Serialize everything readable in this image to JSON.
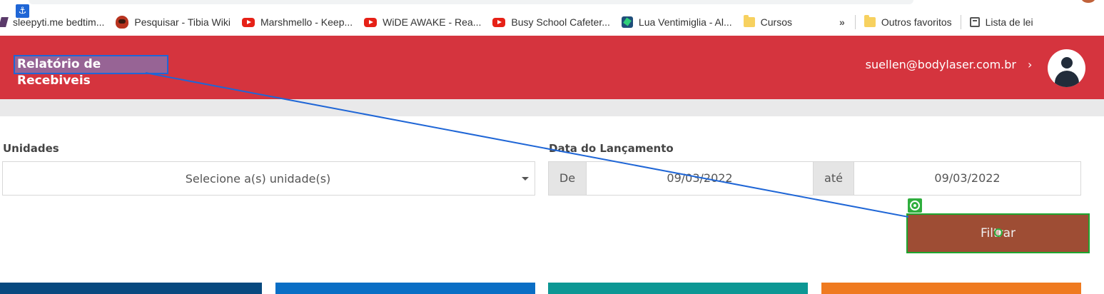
{
  "bookmarks": [
    {
      "label": "sleepyti.me bedtim...",
      "icon": "sleepytime-icon"
    },
    {
      "label": "Pesquisar - Tibia Wiki",
      "icon": "tibia-wiki-icon"
    },
    {
      "label": "Marshmello - Keep...",
      "icon": "youtube-icon"
    },
    {
      "label": "WiDE AWAKE - Rea...",
      "icon": "youtube-icon"
    },
    {
      "label": "Busy School Cafeter...",
      "icon": "youtube-icon"
    },
    {
      "label": "Lua Ventimiglia - Al...",
      "icon": "lua-icon"
    },
    {
      "label": "Cursos",
      "icon": "folder-icon"
    }
  ],
  "bookmarks_more": "»",
  "other_favorites": "Outros favoritos",
  "reading_list": "Lista de lei",
  "header": {
    "title": "Relatório de Recebiveis",
    "user_email": "suellen@bodylaser.com.br",
    "user_chevron": "›",
    "bg_color": "#d5343e"
  },
  "filters": {
    "unidades_label": "Unidades",
    "unidades_placeholder": "Selecione a(s) unidade(s)",
    "date_label": "Data do Lançamento",
    "from_label": "De",
    "from_value": "09/03/2022",
    "to_label": "até",
    "to_value": "09/03/2022"
  },
  "filter_button": {
    "label": "Filtrar",
    "color": "#9e4d34"
  },
  "card_colors": [
    "#08497f",
    "#0a6ec5",
    "#0d9794",
    "#ef7a20"
  ],
  "annotation_colors": {
    "anchor": "#1f66d6",
    "target": "#2fae3e"
  }
}
